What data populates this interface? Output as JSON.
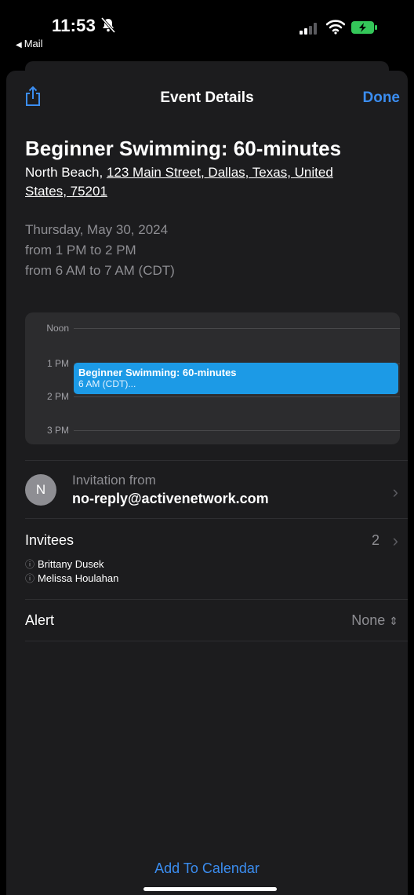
{
  "status_bar": {
    "time": "11:53",
    "back_label": "Mail",
    "icons": [
      "bell-slash-icon",
      "signal-icon",
      "wifi-icon",
      "battery-charging-icon"
    ],
    "battery_color": "#34c759"
  },
  "nav": {
    "title": "Event Details",
    "done_label": "Done",
    "share_icon": "share-icon"
  },
  "event": {
    "title": "Beginner Swimming: 60-minutes",
    "location_prefix": "North Beach, ",
    "address": "123 Main Street, Dallas, Texas, United States, 75201",
    "date": "Thursday, May 30, 2024",
    "time_local": "from 1 PM to 2 PM",
    "time_origin": "from 6 AM to 7 AM (CDT)"
  },
  "calendar": {
    "hours": [
      "Noon",
      "1 PM",
      "2 PM",
      "3 PM"
    ],
    "block_title": "Beginner Swimming: 60-minutes",
    "block_subtitle": "6 AM (CDT)...",
    "block_color": "#1c9ae6"
  },
  "invitation": {
    "avatar_initial": "N",
    "label": "Invitation from",
    "email": "no-reply@activenetwork.com"
  },
  "invitees": {
    "label": "Invitees",
    "count": "2",
    "people": [
      "Brittany Dusek",
      "Melissa Houlahan"
    ]
  },
  "alert": {
    "label": "Alert",
    "value": "None"
  },
  "footer": {
    "add_label": "Add To Calendar"
  },
  "colors": {
    "accent": "#3b8df0",
    "sheet_bg": "#1c1c1e"
  }
}
